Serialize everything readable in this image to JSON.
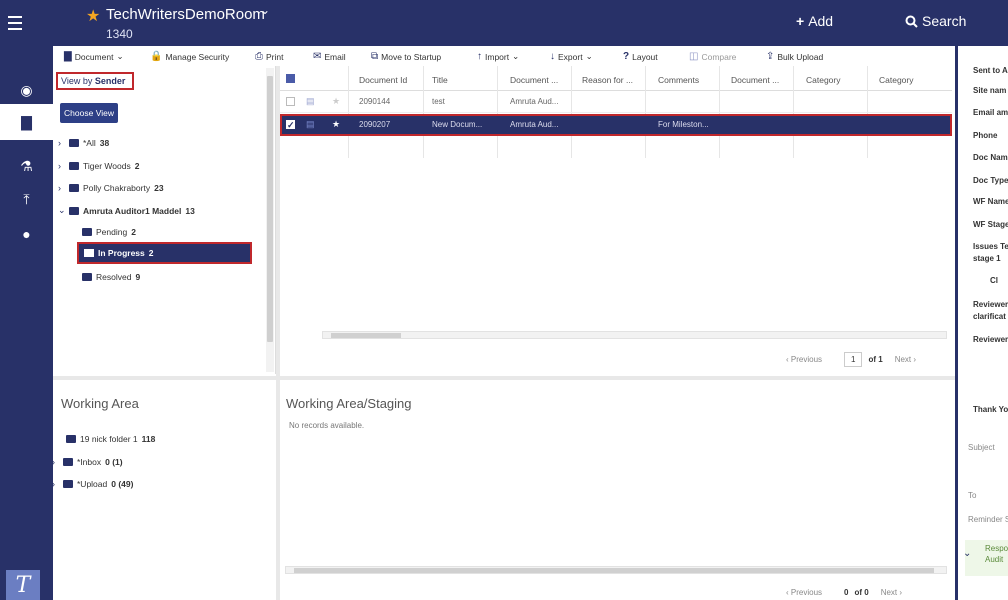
{
  "header": {
    "room_name": "TechWritersDemoRoom",
    "room_id": "1340",
    "add_label": "Add",
    "search_label": "Search"
  },
  "toolbar": {
    "document": "Document",
    "manage_security": "Manage Security",
    "print": "Print",
    "email": "Email",
    "move_to_startup": "Move to Startup",
    "import": "Import",
    "export": "Export",
    "layout": "Layout",
    "compare": "Compare",
    "bulk_upload": "Bulk Upload"
  },
  "tree": {
    "view_by_prefix": "View by",
    "view_by_value": "Sender",
    "choose_view": "Choose View",
    "items": [
      {
        "label": "*All",
        "count": "38"
      },
      {
        "label": "Tiger Woods",
        "count": "2"
      },
      {
        "label": "Polly Chakraborty",
        "count": "23"
      },
      {
        "label": "Amruta Auditor1 Maddel",
        "count": "13"
      },
      {
        "label": "Pending",
        "count": "2"
      },
      {
        "label": "In Progress",
        "count": "2"
      },
      {
        "label": "Resolved",
        "count": "9"
      }
    ]
  },
  "grid": {
    "columns": [
      "Document Id",
      "Title",
      "Document ...",
      "Reason for ...",
      "Comments",
      "Document ...",
      "Category",
      "Category"
    ],
    "rows": [
      {
        "doc_id": "2090144",
        "title": "test",
        "doc": "Amruta Aud...",
        "comments": ""
      },
      {
        "doc_id": "2090207",
        "title": "New Docum...",
        "doc": "Amruta Aud...",
        "comments": "For Mileston..."
      }
    ],
    "pager": {
      "previous": "Previous",
      "page": "1",
      "of": "of 1",
      "next": "Next"
    }
  },
  "working_area": {
    "title": "Working Area",
    "items": [
      {
        "label": "19 nick folder 1",
        "count": "118"
      },
      {
        "label": "*Inbox",
        "count": "0 (1)"
      },
      {
        "label": "*Upload",
        "count": "0 (49)"
      }
    ]
  },
  "staging": {
    "title": "Working Area/Staging",
    "empty": "No records available.",
    "pager": {
      "previous": "Previous",
      "page": "0",
      "of": "of 0",
      "next": "Next"
    }
  },
  "right_panel": {
    "lines": [
      "Sent to A",
      "Site nam",
      "Email am",
      "Phone",
      "Doc Nam",
      "Doc Type",
      "WF Name",
      "WF Stage",
      "Issues Te",
      "stage 1",
      "Cl",
      "Reviewer",
      "clarificat",
      "Reviewer",
      "Thank Yo"
    ],
    "subject": "Subject",
    "to": "To",
    "reminder": "Reminder S",
    "respo": "Respo",
    "audit": "Audit"
  }
}
